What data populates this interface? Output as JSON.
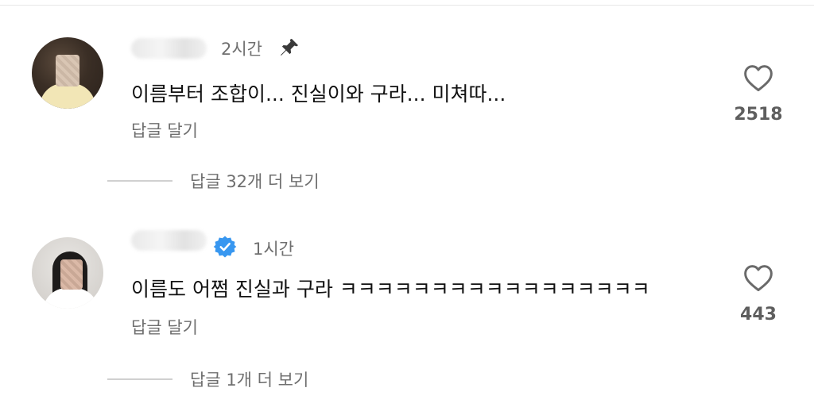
{
  "comments": [
    {
      "time": "2시간",
      "pinned": true,
      "verified": false,
      "text": "이름부터 조합이... 진실이와 구라... 미쳐따...",
      "reply_label": "답글 달기",
      "likes": "2518",
      "more_replies": "답글 32개 더 보기"
    },
    {
      "time": "1시간",
      "pinned": false,
      "verified": true,
      "text": "이름도 어쩜 진실과 구라 ㅋㅋㅋㅋㅋㅋㅋㅋㅋㅋㅋㅋㅋㅋㅋㅋㅋ",
      "reply_label": "답글 달기",
      "likes": "443",
      "more_replies": "답글 1개 더 보기"
    }
  ],
  "icons": {
    "like": "heart-outline-icon",
    "pin": "pin-icon",
    "verified": "verified-badge-icon"
  },
  "colors": {
    "verified_blue": "#3897f0",
    "secondary_text": "#6f6f6f",
    "primary_text": "#111111"
  }
}
